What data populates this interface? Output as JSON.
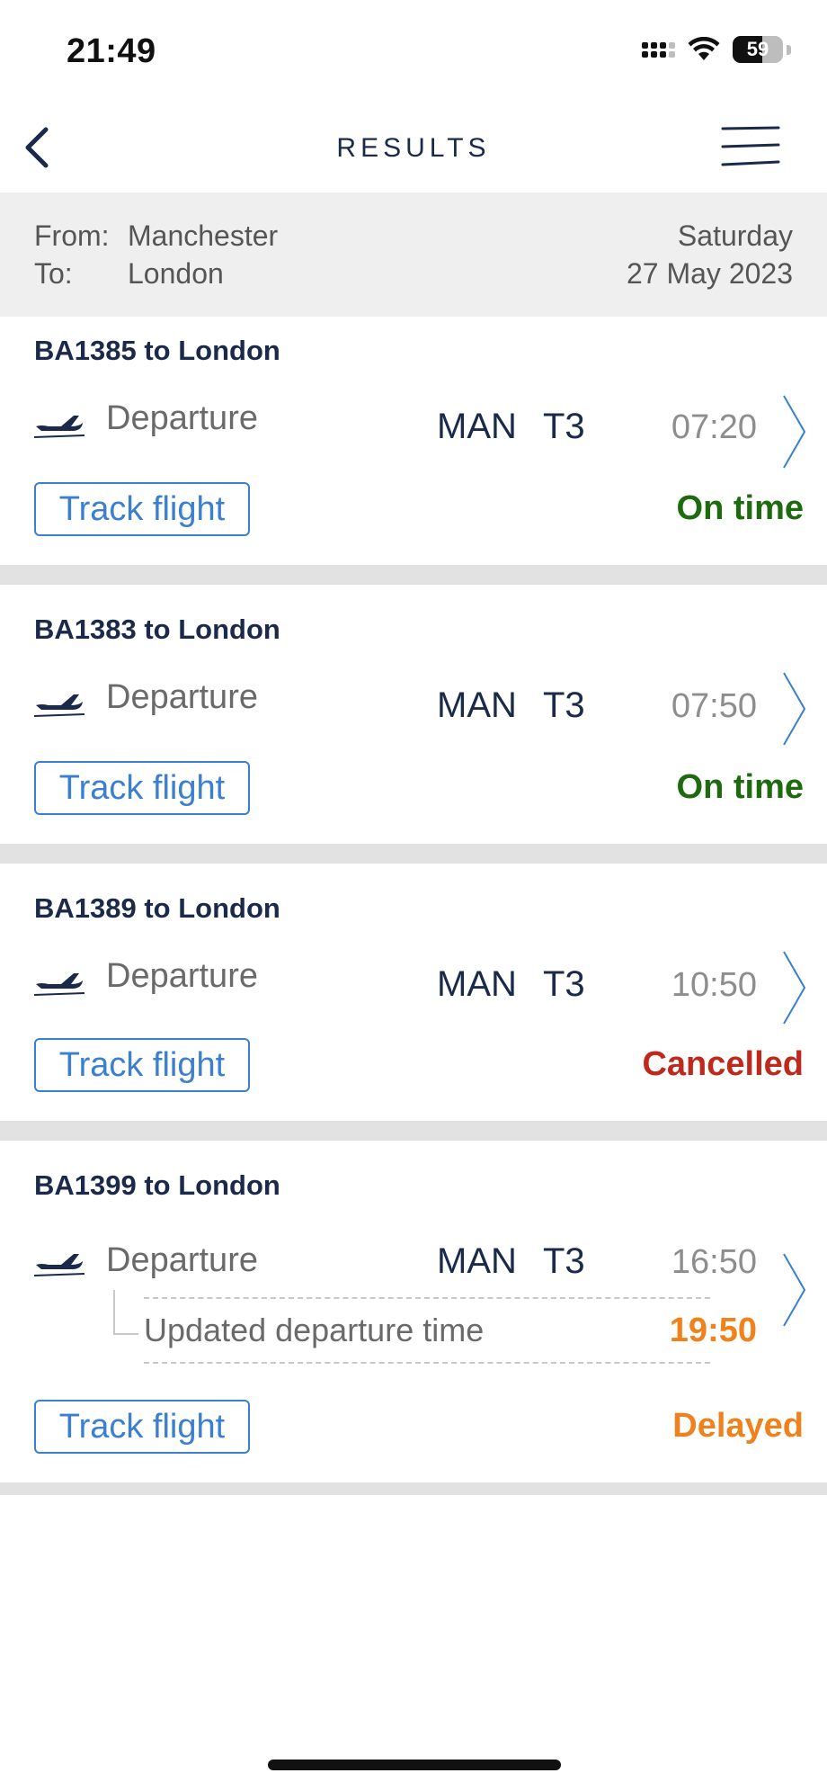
{
  "status_bar": {
    "time": "21:49",
    "battery": "59",
    "battery_level": 0.59
  },
  "header": {
    "title": "RESULTS"
  },
  "search": {
    "from_label": "From:",
    "from_value": "Manchester",
    "to_label": "To:",
    "to_value": "London",
    "day": "Saturday",
    "date": "27 May 2023"
  },
  "flights": [
    {
      "title": "BA1385 to London",
      "direction": "Departure",
      "airport": "MAN",
      "terminal": "T3",
      "time": "07:20",
      "track_label": "Track flight",
      "status": "On time",
      "status_color": "#1e6b0f"
    },
    {
      "title": "BA1383 to London",
      "direction": "Departure",
      "airport": "MAN",
      "terminal": "T3",
      "time": "07:50",
      "track_label": "Track flight",
      "status": "On time",
      "status_color": "#1e6b0f"
    },
    {
      "title": "BA1389 to London",
      "direction": "Departure",
      "airport": "MAN",
      "terminal": "T3",
      "time": "10:50",
      "track_label": "Track flight",
      "status": "Cancelled",
      "status_color": "#c0281c"
    },
    {
      "title": "BA1399 to London",
      "direction": "Departure",
      "airport": "MAN",
      "terminal": "T3",
      "time": "16:50",
      "updated_label": "Updated departure time",
      "updated_time": "19:50",
      "track_label": "Track flight",
      "status": "Delayed",
      "status_color": "#f0821d"
    }
  ],
  "colors": {
    "brand_navy": "#1b2a4a",
    "link_blue": "#3a7fd0",
    "on_time": "#1e6b0f",
    "cancelled": "#c0281c",
    "delayed": "#f0821d"
  }
}
